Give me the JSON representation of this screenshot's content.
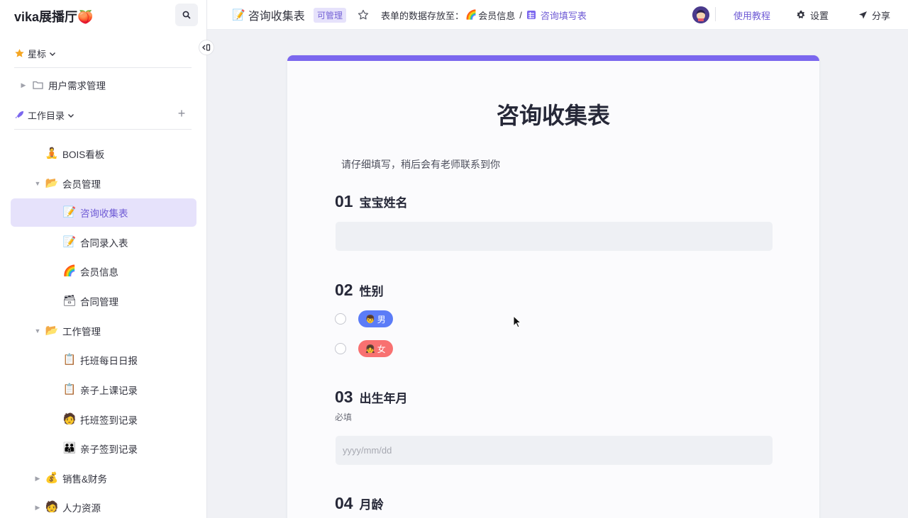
{
  "sidebar": {
    "brand": "vika展播厅🍑",
    "starred_label": "星标",
    "starred_items": [
      {
        "label": "用户需求管理",
        "icon": "folder-icon"
      }
    ],
    "workdir_label": "工作目录",
    "items": [
      {
        "label": "BOIS看板",
        "emoji": "🧘"
      },
      {
        "label": "会员管理",
        "emoji": "📂"
      },
      {
        "label": "咨询收集表",
        "emoji": "📝"
      },
      {
        "label": "合同录入表",
        "emoji": "📝"
      },
      {
        "label": "会员信息",
        "emoji": "🌈"
      },
      {
        "label": "合同管理",
        "emoji": "🗃"
      },
      {
        "label": "工作管理",
        "emoji": "📂"
      },
      {
        "label": "托班每日日报",
        "emoji": "📋"
      },
      {
        "label": "亲子上课记录",
        "emoji": "📋"
      },
      {
        "label": "托班签到记录",
        "emoji": "🧑"
      },
      {
        "label": "亲子签到记录",
        "emoji": "👪"
      },
      {
        "label": "销售&财务",
        "emoji": "💰"
      },
      {
        "label": "人力资源",
        "emoji": "🧑"
      }
    ]
  },
  "topbar": {
    "title_emoji": "📝",
    "title": "咨询收集表",
    "permission_badge": "可管理",
    "storage_label": "表单的数据存放至：",
    "storage_emoji": "🌈",
    "storage_folder": "会员信息",
    "storage_sep": "/",
    "storage_sheet": "咨询填写表",
    "tutorial": "使用教程",
    "settings": "设置",
    "share": "分享"
  },
  "form": {
    "title": "咨询收集表",
    "description": "请仔细填写，稍后会有老师联系到你",
    "questions": [
      {
        "num": "01",
        "label": "宝宝姓名",
        "placeholder": ""
      },
      {
        "num": "02",
        "label": "性别",
        "options": [
          {
            "label": "男",
            "emoji": "👦",
            "color": "#5b7cf7"
          },
          {
            "label": "女",
            "emoji": "👧",
            "color": "#f87171"
          }
        ]
      },
      {
        "num": "03",
        "label": "出生年月",
        "required_text": "必填",
        "placeholder": "yyyy/mm/dd"
      },
      {
        "num": "04",
        "label": "月龄"
      }
    ]
  },
  "colors": {
    "accent": "#7b67ee",
    "active_bg": "#e6e2fb",
    "active_text": "#6f5bd5",
    "link": "#6f5bd5"
  }
}
